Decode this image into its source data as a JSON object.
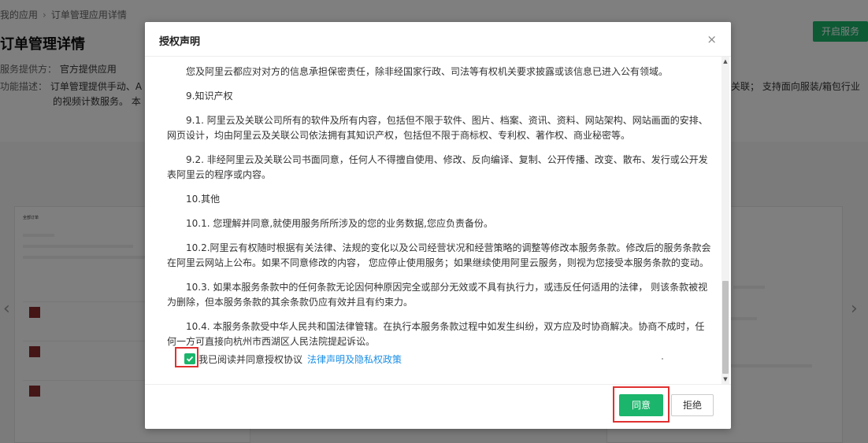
{
  "breadcrumb": {
    "root": "我的应用",
    "separator": "›",
    "current": "订单管理应用详情"
  },
  "page": {
    "title": "订单管理详情",
    "start_button": "开启服务",
    "provider_label": "服务提供方：",
    "provider_value": "官方提供应用",
    "desc_label": "功能描述：",
    "desc_line1_visible": "订单管理提供手动、A",
    "desc_tail": "关联； 支持面向服装/箱包行业",
    "desc_line2": "的视频计数服务。 本",
    "thumb_title": "全部订单"
  },
  "modal": {
    "title": "授权声明",
    "close": "×",
    "paragraphs": [
      "您及阿里云都应对对方的信息承担保密责任，除非经国家行政、司法等有权机关要求披露或该信息已进入公有领域。",
      "9.知识产权",
      "9.1. 阿里云及关联公司所有的软件及所有内容，包括但不限于软件、图片、档案、资讯、资料、网站架构、网站画面的安排、网页设计，均由阿里云及关联公司依法拥有其知识产权，包括但不限于商标权、专利权、著作权、商业秘密等。",
      "9.2. 非经阿里云及关联公司书面同意，任何人不得擅自使用、修改、反向编译、复制、公开传播、改变、散布、发行或公开发表阿里云的程序或内容。",
      "10.其他",
      "10.1. 您理解并同意,就使用服务所所涉及的您的业务数据,您应负责备份。",
      "10.2.阿里云有权随时根据有关法律、法规的变化以及公司经营状况和经营策略的调整等修改本服务条款。修改后的服务条款会在阿里云网站上公布。如果不同意修改的内容， 您应停止使用服务；如果继续使用阿里云服务，则视为您接受本服务条款的变动。",
      "10.3. 如果本服务条款中的任何条款无论因何种原因完全或部分无效或不具有执行力，或违反任何适用的法律， 则该条款被视为删除，但本服务条款的其余条款仍应有效并且有约束力。",
      "10.4. 本服务条款受中华人民共和国法律管辖。在执行本服务条款过程中如发生纠纷，双方应及时协商解决。协商不成时，任何一方可直接向杭州市西湖区人民法院提起诉讼。"
    ],
    "agree_text": "我已阅读并同意授权协议",
    "policy_link": "法律声明及隐私权政策",
    "agree_button": "同意",
    "reject_button": "拒绝",
    "checked": true
  },
  "colors": {
    "accent": "#1bb56b",
    "link": "#1b8fe6",
    "highlight": "#e03030"
  }
}
